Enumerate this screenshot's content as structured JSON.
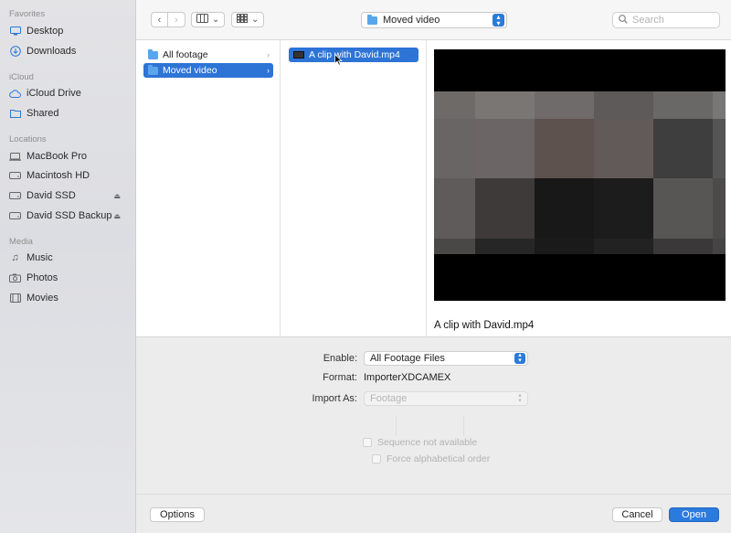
{
  "sidebar": {
    "sections": [
      {
        "title": "Favorites",
        "items": [
          {
            "label": "Desktop",
            "icon": "desktop-icon"
          },
          {
            "label": "Downloads",
            "icon": "downloads-icon"
          }
        ]
      },
      {
        "title": "iCloud",
        "items": [
          {
            "label": "iCloud Drive",
            "icon": "cloud-icon"
          },
          {
            "label": "Shared",
            "icon": "shared-folder-icon"
          }
        ]
      },
      {
        "title": "Locations",
        "items": [
          {
            "label": "MacBook Pro",
            "icon": "laptop-icon"
          },
          {
            "label": "Macintosh HD",
            "icon": "drive-icon"
          },
          {
            "label": "David SSD",
            "icon": "drive-icon"
          },
          {
            "label": "David SSD Backup",
            "icon": "drive-icon"
          }
        ]
      },
      {
        "title": "Media",
        "items": [
          {
            "label": "Music",
            "icon": "music-icon"
          },
          {
            "label": "Photos",
            "icon": "camera-icon"
          },
          {
            "label": "Movies",
            "icon": "film-icon"
          }
        ]
      }
    ]
  },
  "toolbar": {
    "location": "Moved video",
    "search_placeholder": "Search"
  },
  "browser": {
    "column1": [
      {
        "label": "All footage",
        "selected": false
      },
      {
        "label": "Moved video",
        "selected": true
      }
    ],
    "column2": [
      {
        "label": "A clip with David.mp4",
        "selected": true
      }
    ],
    "preview_name": "A clip with David.mp4"
  },
  "options": {
    "enable_label": "Enable:",
    "enable_value": "All Footage Files",
    "format_label": "Format:",
    "format_value": "ImporterXDCAMEX",
    "import_as_label": "Import As:",
    "import_as_value": "Footage",
    "sequence_label": "Sequence not available",
    "alphabetical_label": "Force alphabetical order"
  },
  "buttons": {
    "options": "Options",
    "cancel": "Cancel",
    "open": "Open"
  },
  "colors": {
    "accent": "#2b7bde",
    "selection": "#2d74d6"
  }
}
